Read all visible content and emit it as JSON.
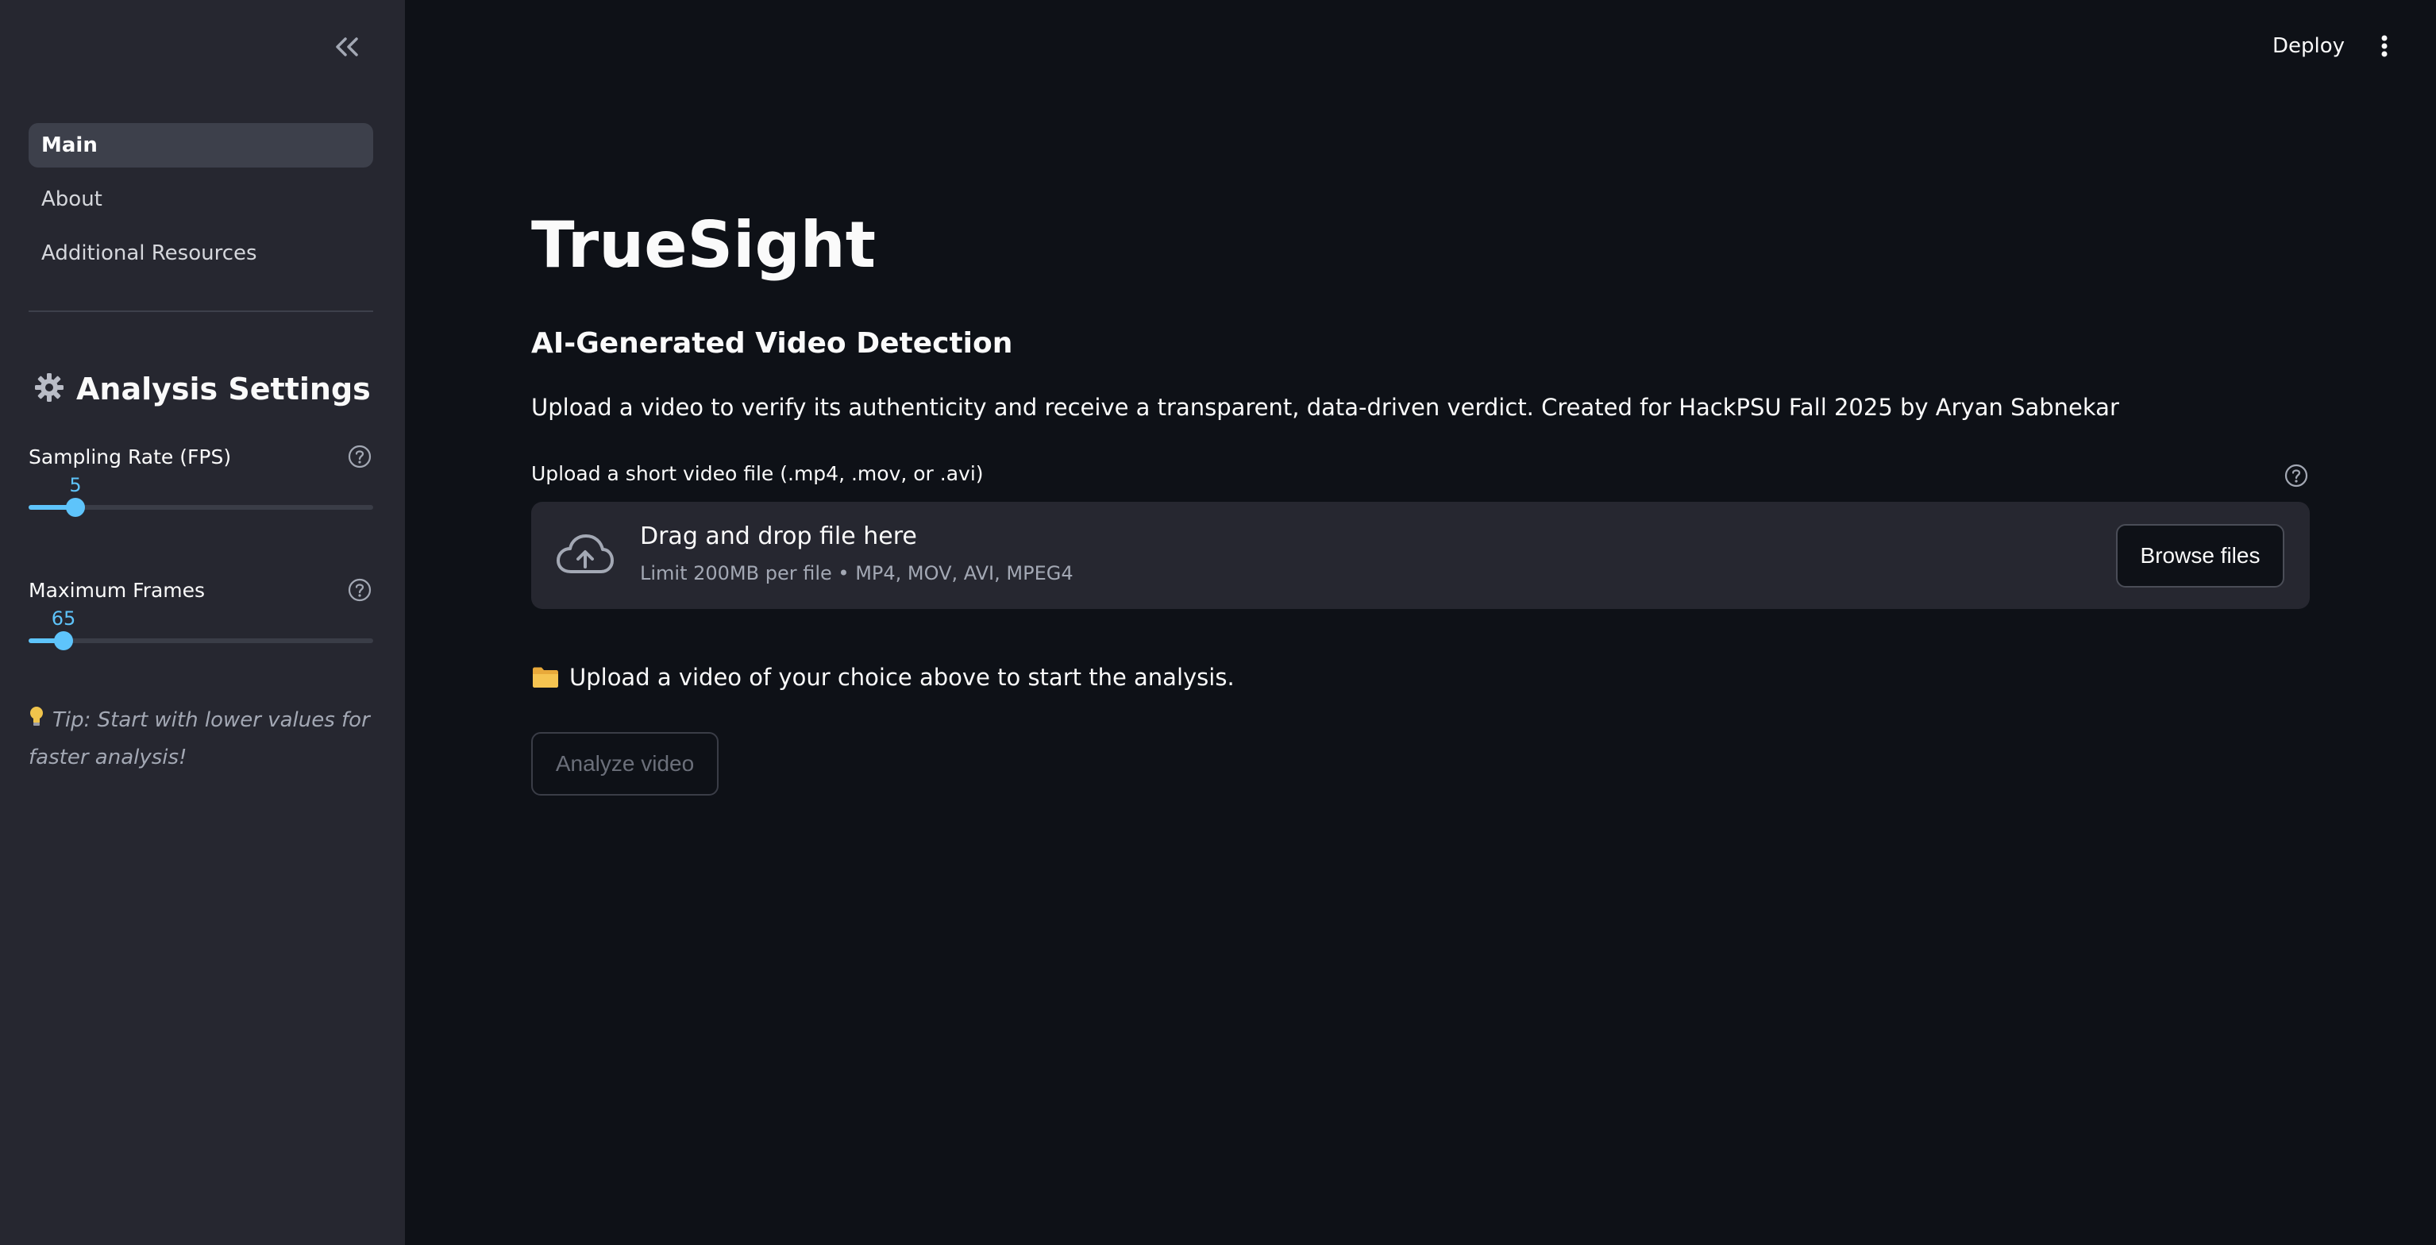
{
  "sidebar": {
    "collapse_icon": "double-chevron-left-icon",
    "nav_items": [
      {
        "label": "Main",
        "active": true
      },
      {
        "label": "About",
        "active": false
      },
      {
        "label": "Additional Resources",
        "active": false
      }
    ],
    "settings_title": "Analysis Settings",
    "settings_icon": "gear-icon",
    "sliders": [
      {
        "label": "Sampling Rate (FPS)",
        "value": "5",
        "fraction": 0.136
      },
      {
        "label": "Maximum Frames",
        "value": "65",
        "fraction": 0.101
      }
    ],
    "tip": "Tip: Start with lower values for faster analysis!",
    "tip_icon": "lightbulb-icon"
  },
  "header": {
    "deploy_label": "Deploy",
    "menu_icon": "vertical-dots-icon"
  },
  "main": {
    "title": "TrueSight",
    "subtitle": "AI-Generated Video Detection",
    "description": "Upload a video to verify its authenticity and receive a transparent, data-driven verdict. Created for HackPSU Fall 2025 by Aryan Sabnekar",
    "upload": {
      "label": "Upload a short video file (.mp4, .mov, or .avi)",
      "dropzone_title": "Drag and drop file here",
      "dropzone_sub": "Limit 200MB per file • MP4, MOV, AVI, MPEG4",
      "browse_label": "Browse files",
      "icon": "cloud-upload-icon"
    },
    "info_text": "Upload a video of your choice above to start the analysis.",
    "info_icon": "folder-icon",
    "analyze_label": "Analyze video"
  },
  "colors": {
    "background": "#0e1117",
    "sidebar": "#262730",
    "accent": "#5ec4fb",
    "text": "#fafafa",
    "muted": "#a3a8b4"
  }
}
